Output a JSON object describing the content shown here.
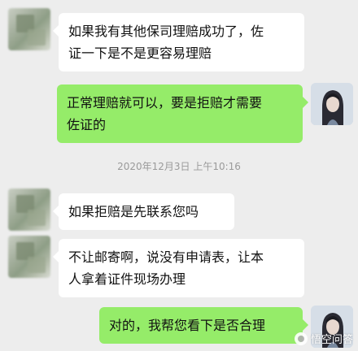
{
  "messages": [
    {
      "side": "in",
      "text_line1": "如果我有其他保司理赔成功了，佐",
      "text_line2": "证一下是不是更容易理赔"
    },
    {
      "side": "out",
      "text_line1": "正常理赔就可以，要是拒赔才需要",
      "text_line2": "佐证的"
    },
    {
      "side": "in",
      "text_line1": "如果拒赔是先联系您吗"
    },
    {
      "side": "in",
      "text_line1": "不让邮寄啊，说没有申请表，让本",
      "text_line2": "人拿着证件现场办理"
    },
    {
      "side": "out",
      "text_line1": "对的，我帮您看下是否合理"
    }
  ],
  "timestamp": "2020年12月3日 上午10:16",
  "watermark": "悟空问答",
  "colors": {
    "background": "#ededed",
    "incoming_bubble": "#ffffff",
    "outgoing_bubble": "#95ec69",
    "timestamp_text": "#9a9a9a"
  }
}
